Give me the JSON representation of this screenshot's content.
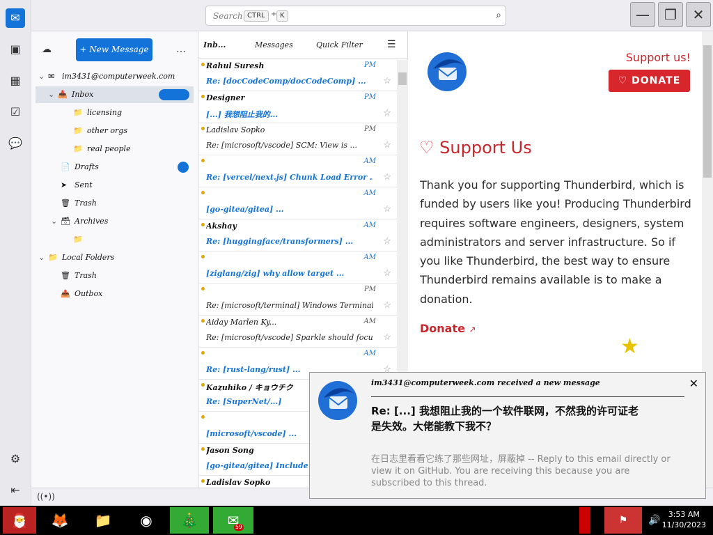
{
  "search": {
    "placeholder": "Search...",
    "kbd1": "CTRL",
    "kbd2": "K"
  },
  "folder_pane": {
    "new_message": "+ New Message",
    "more": "…",
    "account": "im3431@computerweek.com",
    "items": [
      {
        "label": "Inbox",
        "icon": "📥",
        "badge": "",
        "selected": true
      },
      {
        "label": "licensing",
        "icon": "📁"
      },
      {
        "label": "other orgs",
        "icon": "📁"
      },
      {
        "label": "real people",
        "icon": "📁"
      },
      {
        "label": "Drafts",
        "icon": "📄",
        "badge": ""
      },
      {
        "label": "Sent",
        "icon": "➤"
      },
      {
        "label": "Trash",
        "icon": "🗑"
      },
      {
        "label": "Archives",
        "icon": "🗃"
      },
      {
        "label": "",
        "icon": "📁"
      },
      {
        "label": "Local Folders",
        "icon": "📁"
      },
      {
        "label": "Trash",
        "icon": "🗑"
      },
      {
        "label": "Outbox",
        "icon": "📤"
      }
    ]
  },
  "message_list": {
    "header_label": "Messages",
    "quick_filter": "Quick Filter",
    "messages": [
      {
        "from": "Rahul Suresh",
        "date": "PM",
        "subject": "Re: [docCodeComp/docCodeComp] ..."
      },
      {
        "from": "Designer",
        "date": "PM",
        "subject": "[...] 我想阻止我的..."
      },
      {
        "from": "Ladislav Sopko",
        "date": "PM",
        "subject": "Re: [microsoft/vscode] SCM: View is ..."
      },
      {
        "from": "",
        "date": "AM",
        "subject": "Re: [vercel/next.js] Chunk Load Error ..."
      },
      {
        "from": "",
        "date": "AM",
        "subject": "[go-gitea/gitea] ..."
      },
      {
        "from": "Akshay",
        "date": "AM",
        "subject": "Re: [huggingface/transformers] ..."
      },
      {
        "from": "",
        "date": "AM",
        "subject": "[ziglang/zig] why allow target ..."
      },
      {
        "from": "",
        "date": "PM",
        "subject": "Re: [microsoft/terminal] Windows Terminal ..."
      },
      {
        "from": "Aiday Marlen Ky...",
        "date": "AM",
        "subject": "Re: [microsoft/vscode] Sparkle should focus..."
      },
      {
        "from": "",
        "date": "AM",
        "subject": "Re: [rust-lang/rust] ..."
      },
      {
        "from": "Kazuhiko / キョウチク",
        "date": "",
        "subject": "Re: [SuperNet/...]"
      },
      {
        "from": "",
        "date": "",
        "subject": "[microsoft/vscode] ..."
      },
      {
        "from": "Jason Song",
        "date": "",
        "subject": "[go-gitea/gitea] Include ..."
      },
      {
        "from": "Ladislav Sopko",
        "date": "",
        "subject": ""
      }
    ]
  },
  "content": {
    "support_link": "Support us!",
    "donate_button": "DONATE",
    "title": "Support Us",
    "body": "Thank you for supporting Thunderbird, which is funded by users like you! Producing Thunderbird requires software engineers, designers, system administrators and server infrastructure. So if you like Thunderbird, the best way to ensure Thunderbird remains available is to make a donation.",
    "donate_link": "Donate"
  },
  "notification": {
    "title": "im3431@computerweek.com received a new message",
    "subject": "Re: [...] 我想阻止我的一个软件联网，不然我的许可证老是失效。大佬能教下我不？",
    "preview": "在日志里看看它练了那些网址，屏蔽掉 -- Reply to this email directly or view it on GitHub. You are receiving this because you are subscribed to this thread."
  },
  "taskbar": {
    "time": "3:53 AM",
    "date": "11/30/2023",
    "badge_count": "59"
  }
}
